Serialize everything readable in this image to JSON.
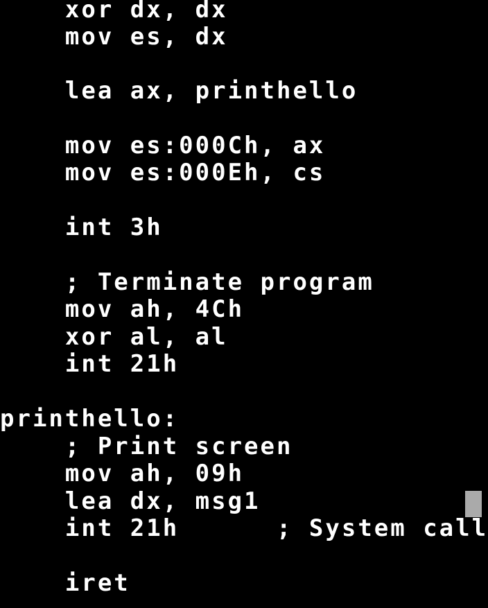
{
  "screen": {
    "background": "#000000",
    "foreground": "#ffffff",
    "cursor_color": "#aaaaaa",
    "lines": [
      "    xor dx, dx",
      "    mov es, dx",
      "",
      "    lea ax, printhello",
      "",
      "    mov es:000Ch, ax",
      "    mov es:000Eh, cs",
      "",
      "    int 3h",
      "",
      "    ; Terminate program",
      "    mov ah, 4Ch",
      "    xor al, al",
      "    int 21h",
      "",
      "printhello:",
      "    ; Print screen",
      "    mov ah, 09h",
      "    lea dx, msg1",
      "    int 21h      ; System call",
      "",
      "    iret"
    ]
  }
}
